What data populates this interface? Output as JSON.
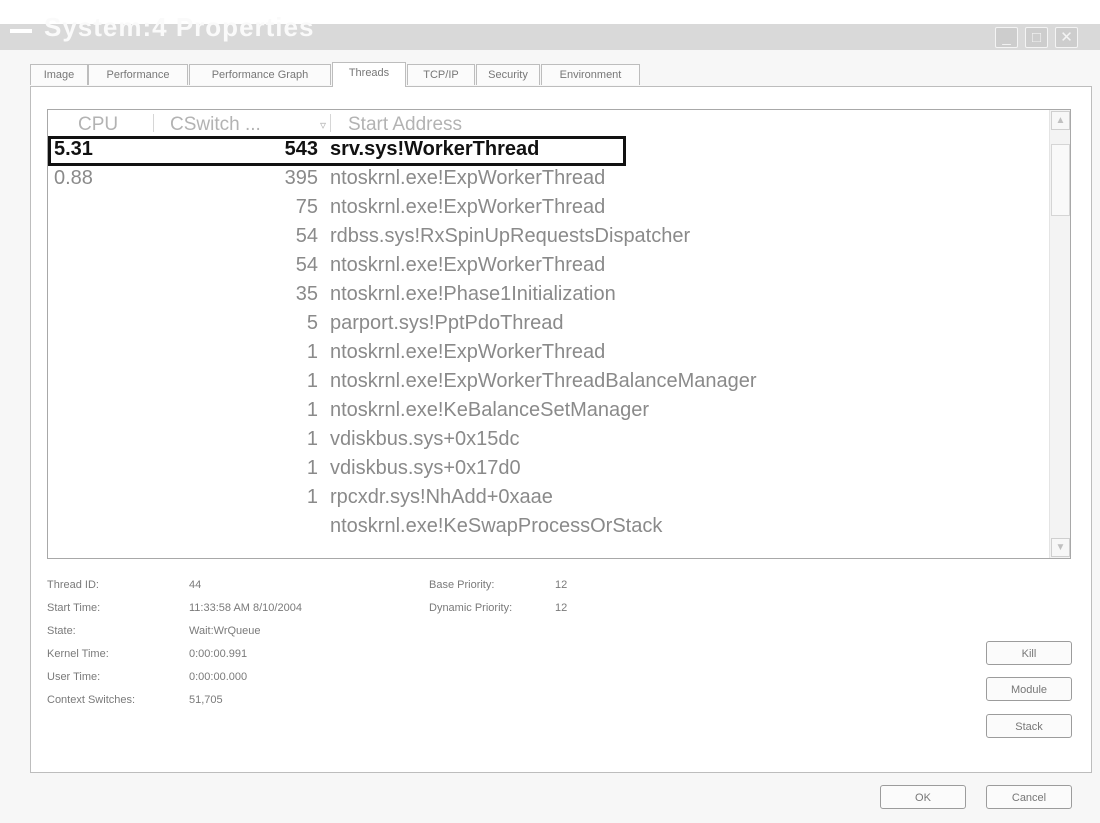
{
  "window": {
    "title": "System:4 Properties",
    "controls": [
      "minimize-icon",
      "maximize-icon",
      "close-icon"
    ]
  },
  "tabs": [
    {
      "label": "Image",
      "active": false
    },
    {
      "label": "Performance",
      "active": false
    },
    {
      "label": "Performance Graph",
      "active": false
    },
    {
      "label": "Threads",
      "active": true
    },
    {
      "label": "TCP/IP",
      "active": false
    },
    {
      "label": "Security",
      "active": false
    },
    {
      "label": "Environment",
      "active": false
    }
  ],
  "threads": {
    "columns": {
      "cpu": "CPU",
      "cswitch": "CSwitch ...",
      "sort_arrow": "▿",
      "start": "Start Address"
    },
    "rows": [
      {
        "cpu": "5.31",
        "cswitch": "543",
        "start": "srv.sys!WorkerThread",
        "selected": true
      },
      {
        "cpu": "0.88",
        "cswitch": "395",
        "start": "ntoskrnl.exe!ExpWorkerThread"
      },
      {
        "cpu": "",
        "cswitch": "75",
        "start": "ntoskrnl.exe!ExpWorkerThread"
      },
      {
        "cpu": "",
        "cswitch": "54",
        "start": "rdbss.sys!RxSpinUpRequestsDispatcher"
      },
      {
        "cpu": "",
        "cswitch": "54",
        "start": "ntoskrnl.exe!ExpWorkerThread"
      },
      {
        "cpu": "",
        "cswitch": "35",
        "start": "ntoskrnl.exe!Phase1Initialization"
      },
      {
        "cpu": "",
        "cswitch": "5",
        "start": "parport.sys!PptPdoThread"
      },
      {
        "cpu": "",
        "cswitch": "1",
        "start": "ntoskrnl.exe!ExpWorkerThread"
      },
      {
        "cpu": "",
        "cswitch": "1",
        "start": "ntoskrnl.exe!ExpWorkerThreadBalanceManager"
      },
      {
        "cpu": "",
        "cswitch": "1",
        "start": "ntoskrnl.exe!KeBalanceSetManager"
      },
      {
        "cpu": "",
        "cswitch": "1",
        "start": "vdiskbus.sys+0x15dc"
      },
      {
        "cpu": "",
        "cswitch": "1",
        "start": "vdiskbus.sys+0x17d0"
      },
      {
        "cpu": "",
        "cswitch": "1",
        "start": "rpcxdr.sys!NhAdd+0xaae"
      },
      {
        "cpu": "",
        "cswitch": "",
        "start": "ntoskrnl.exe!KeSwapProcessOrStack"
      }
    ]
  },
  "details": {
    "thread_id": {
      "label": "Thread ID:",
      "value": "44"
    },
    "start_time": {
      "label": "Start Time:",
      "value": "11:33:58 AM   8/10/2004"
    },
    "state": {
      "label": "State:",
      "value": "Wait:WrQueue"
    },
    "kernel_time": {
      "label": "Kernel Time:",
      "value": "0:00:00.991"
    },
    "user_time": {
      "label": "User Time:",
      "value": "0:00:00.000"
    },
    "context_switches": {
      "label": "Context Switches:",
      "value": "51,705"
    },
    "base_priority": {
      "label": "Base Priority:",
      "value": "12"
    },
    "dynamic_priority": {
      "label": "Dynamic Priority:",
      "value": "12"
    }
  },
  "buttons": {
    "kill": "Kill",
    "module": "Module",
    "stack": "Stack",
    "ok": "OK",
    "cancel": "Cancel"
  }
}
